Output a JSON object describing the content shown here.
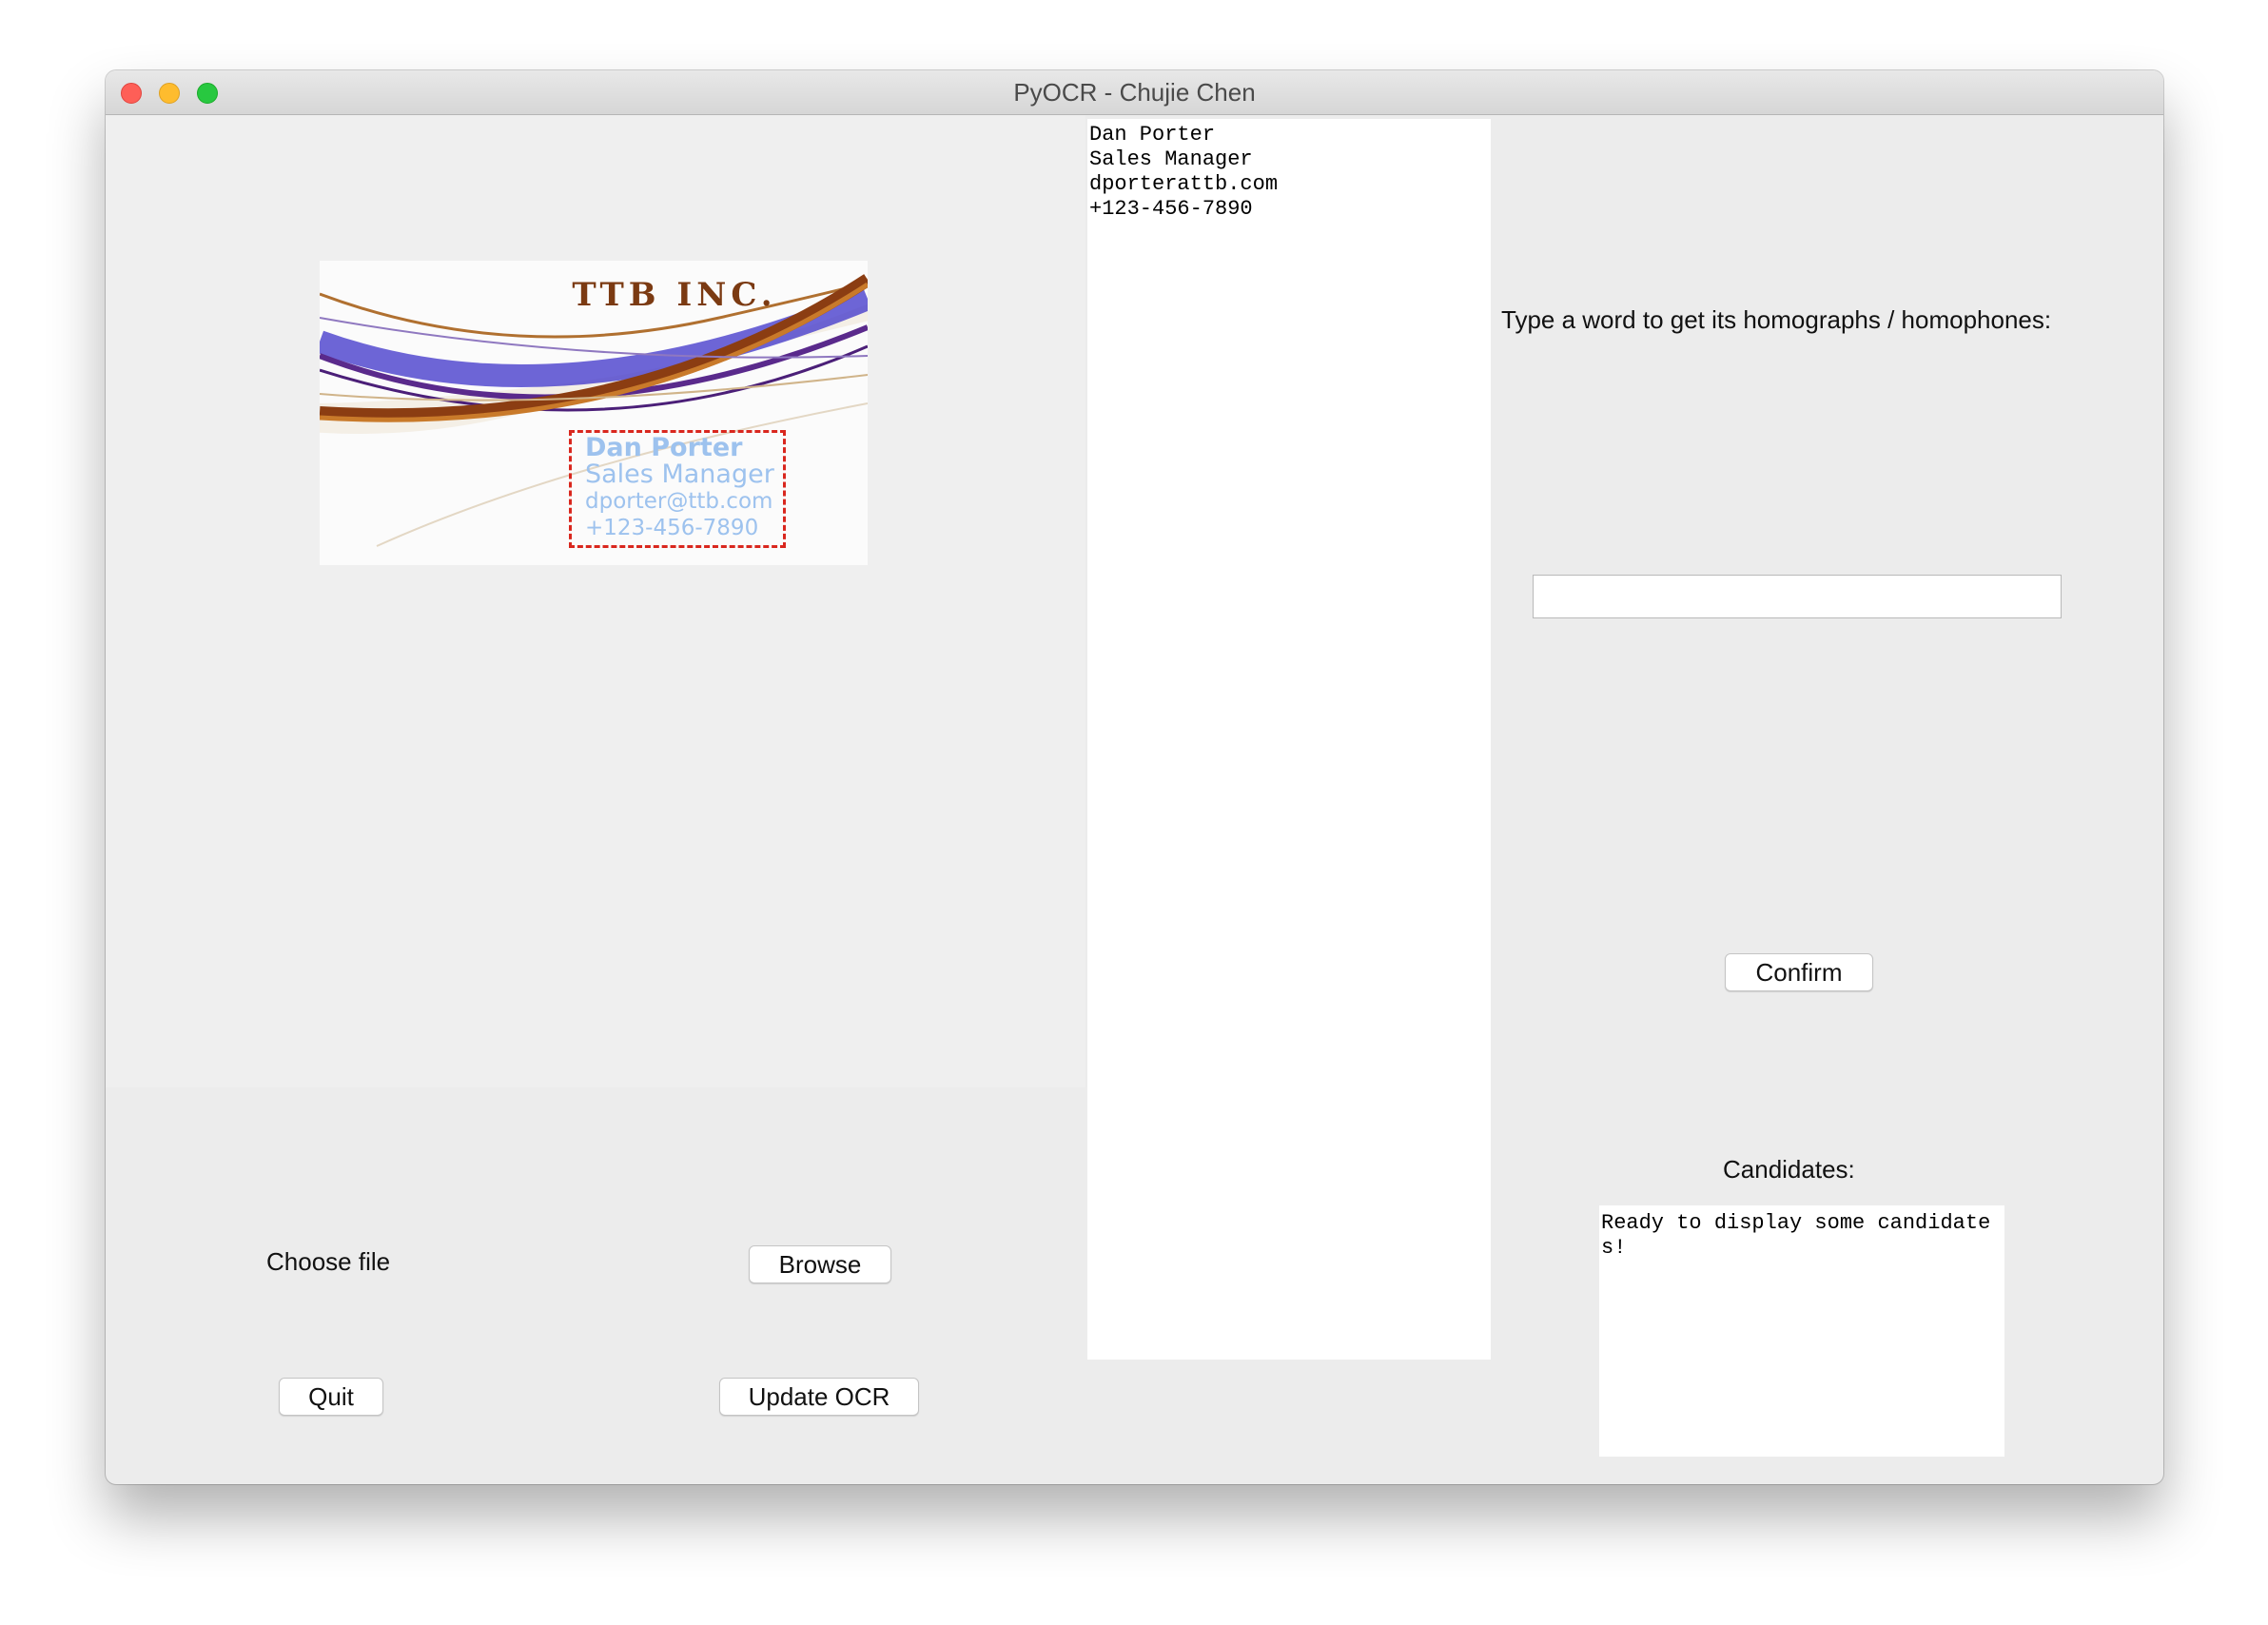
{
  "window": {
    "title": "PyOCR - Chujie Chen"
  },
  "card": {
    "company": "TTB INC.",
    "name": "Dan Porter",
    "role": "Sales Manager",
    "email": "dporter@ttb.com",
    "phone": "+123-456-7890"
  },
  "controls": {
    "choose_file_label": "Choose file",
    "browse_label": "Browse",
    "quit_label": "Quit",
    "update_ocr_label": "Update OCR"
  },
  "ocr_output": {
    "text": "Dan Porter\nSales Manager\ndporterattb.com\n+123-456-7890"
  },
  "homograph": {
    "prompt": "Type a word to get its homographs / homophones:",
    "input_value": "",
    "confirm_label": "Confirm",
    "candidates_label": "Candidates:",
    "candidates_text": "Ready to display some candidates!"
  },
  "colors": {
    "ocr_box_border": "#d9271e",
    "card_text": "#9dc2ee",
    "company_text": "#7b3a12"
  }
}
